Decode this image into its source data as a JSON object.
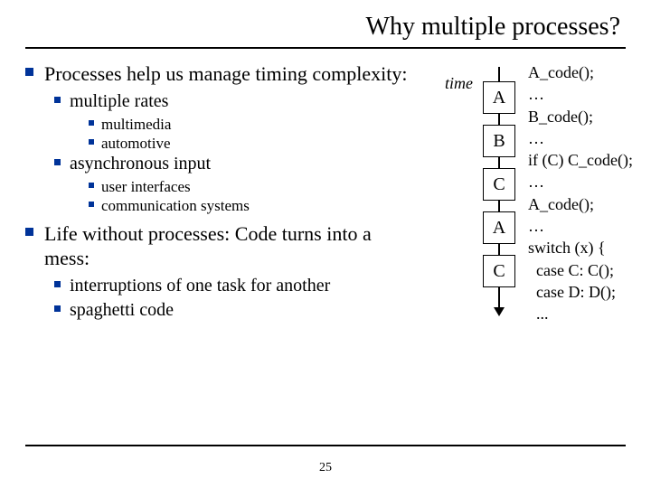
{
  "title": "Why multiple processes?",
  "page_number": "25",
  "bullets": {
    "b1": "Processes help us manage timing complexity:",
    "b1a": "multiple rates",
    "b1a1": "multimedia",
    "b1a2": "automotive",
    "b1b": "asynchronous input",
    "b1b1": "user interfaces",
    "b1b2": "communication systems",
    "b2": "Life without processes: Code turns into a mess:",
    "b2a": "interruptions of one task for another",
    "b2b": "spaghetti code"
  },
  "time_label": "time",
  "timeline": [
    "A",
    "B",
    "C",
    "A",
    "C"
  ],
  "code": "A_code();\n…\nB_code();\n…\nif (C) C_code();\n…\nA_code();\n…\nswitch (x) {\n  case C: C();\n  case D: D();\n  ..."
}
